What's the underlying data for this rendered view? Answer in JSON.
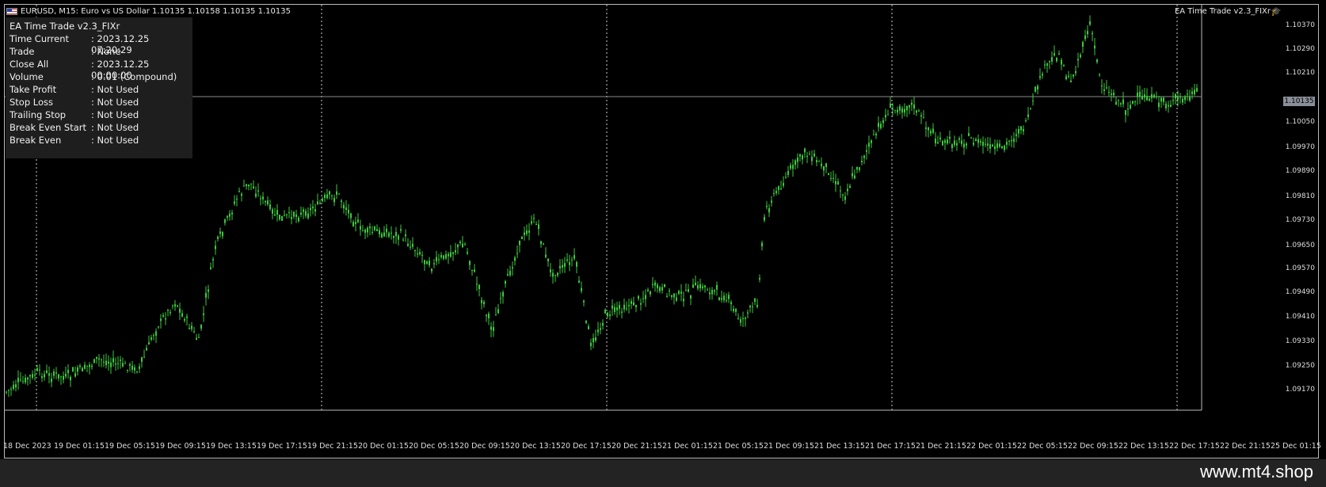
{
  "window": {
    "title": "EURUSD, M15:  Euro vs US Dollar  1.10135 1.10158 1.10135 1.10135",
    "ea_name": "EA Time Trade v2.3_FIXr",
    "symbol_flag_icon": "eu-us-flag-icon",
    "ea_icon": "graduation-cap-icon"
  },
  "info_panel": {
    "title": "EA Time Trade v2.3_FIXr",
    "rows": [
      {
        "key": "Time Current",
        "value": ": 2023.12.25 07:20:29"
      },
      {
        "key": "Trade",
        "value": ": None"
      },
      {
        "key": "Close All",
        "value": ": 2023.12.25 00:00:00"
      },
      {
        "key": "Volume",
        "value": ": 0.01 (Compound)"
      },
      {
        "key": "Take Profit",
        "value": ": Not Used"
      },
      {
        "key": "Stop Loss",
        "value": ": Not Used"
      },
      {
        "key": "Trailing Stop",
        "value": ": Not Used"
      },
      {
        "key": "Break Even Start",
        "value": ": Not Used"
      },
      {
        "key": "Break Even",
        "value": ": Not Used"
      }
    ]
  },
  "price_axis": [
    "1.10370",
    "1.10290",
    "1.10210",
    "1.10135",
    "1.10050",
    "1.09970",
    "1.09890",
    "1.09810",
    "1.09730",
    "1.09650",
    "1.09570",
    "1.09490",
    "1.09410",
    "1.09330",
    "1.09250",
    "1.09170"
  ],
  "time_axis": [
    "18 Dec 2023",
    "19 Dec 01:15",
    "19 Dec 05:15",
    "19 Dec 09:15",
    "19 Dec 13:15",
    "19 Dec 17:15",
    "19 Dec 21:15",
    "20 Dec 01:15",
    "20 Dec 05:15",
    "20 Dec 09:15",
    "20 Dec 13:15",
    "20 Dec 17:15",
    "20 Dec 21:15",
    "21 Dec 01:15",
    "21 Dec 05:15",
    "21 Dec 09:15",
    "21 Dec 13:15",
    "21 Dec 17:15",
    "21 Dec 21:15",
    "22 Dec 01:15",
    "22 Dec 05:15",
    "22 Dec 09:15",
    "22 Dec 13:15",
    "22 Dec 17:15",
    "22 Dec 21:15",
    "25 Dec 01:15"
  ],
  "bid_price": "1.10135",
  "colors": {
    "candle": "#3ec93e",
    "background": "#000000",
    "grid": "#bbbbbb"
  },
  "footer": {
    "site": "www.mt4.shop"
  }
}
